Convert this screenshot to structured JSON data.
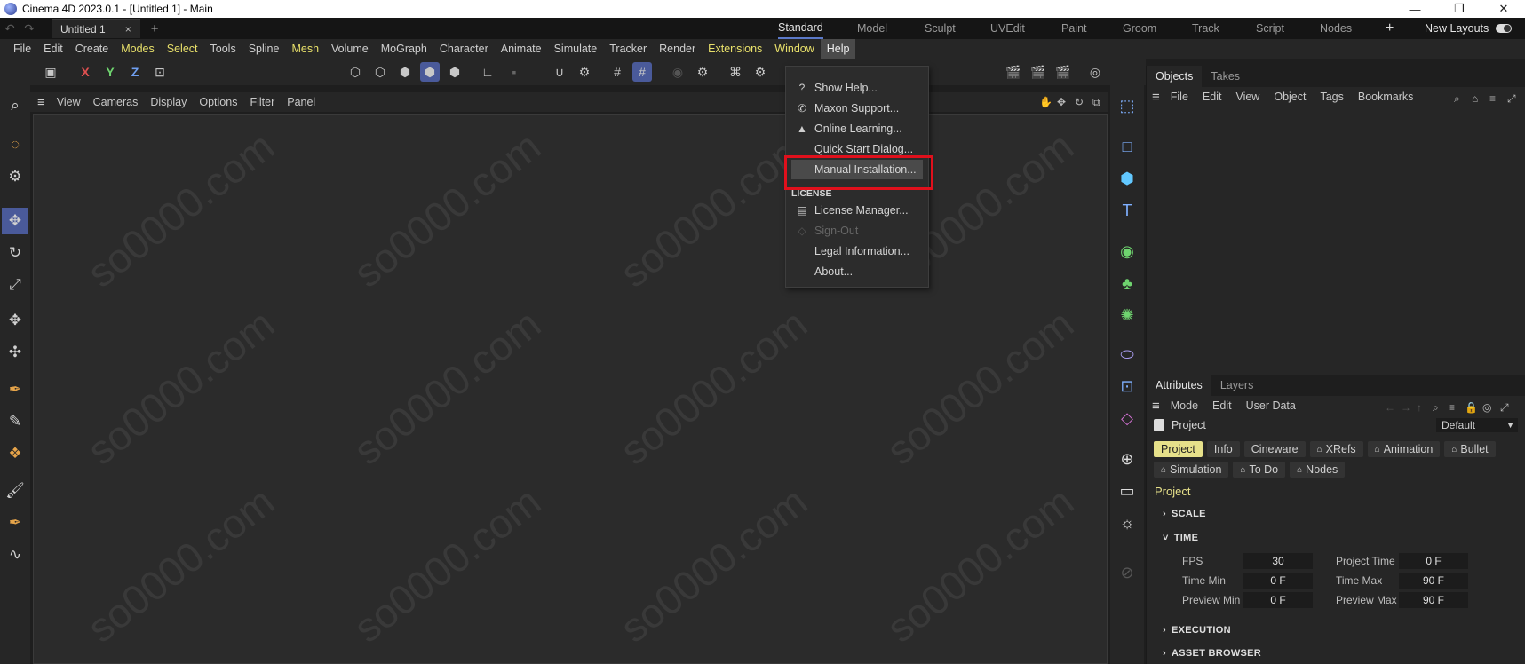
{
  "window": {
    "title": "Cinema 4D 2023.0.1 - [Untitled 1] - Main"
  },
  "doc_tab": {
    "label": "Untitled 1",
    "close": "×",
    "add": "+"
  },
  "layouts": [
    "Standard",
    "Model",
    "Sculpt",
    "UVEdit",
    "Paint",
    "Groom",
    "Track",
    "Script",
    "Nodes"
  ],
  "layouts_add": "+",
  "new_layouts": "New Layouts",
  "menubar": [
    "File",
    "Edit",
    "Create",
    "Modes",
    "Select",
    "Tools",
    "Spline",
    "Mesh",
    "Volume",
    "MoGraph",
    "Character",
    "Animate",
    "Simulate",
    "Tracker",
    "Render",
    "Extensions",
    "Window",
    "Help"
  ],
  "menubar_highlight": [
    "Modes",
    "Select",
    "Mesh",
    "Extensions",
    "Window"
  ],
  "menubar_active": "Help",
  "axes": [
    "X",
    "Y",
    "Z"
  ],
  "viewport_menu": [
    "View",
    "Cameras",
    "Display",
    "Options",
    "Filter",
    "Panel"
  ],
  "help_menu": {
    "items": [
      {
        "label": "Show Help...",
        "icon": "question-icon"
      },
      {
        "label": "Maxon Support...",
        "icon": "phone-icon"
      },
      {
        "label": "Online Learning...",
        "icon": "graduation-cap-icon"
      },
      {
        "label": "Quick Start Dialog...",
        "icon": ""
      },
      {
        "label": "Manual Installation...",
        "icon": ""
      }
    ],
    "license_header": "LICENSE",
    "license_items": [
      {
        "label": "License Manager...",
        "icon": "license-icon",
        "disabled": false
      },
      {
        "label": "Sign-Out",
        "icon": "signout-icon",
        "disabled": true
      },
      {
        "label": "Legal Information...",
        "icon": "",
        "disabled": false
      },
      {
        "label": "About...",
        "icon": "",
        "disabled": false
      }
    ]
  },
  "objects_panel": {
    "tabs": [
      "Objects",
      "Takes"
    ],
    "menu": [
      "File",
      "Edit",
      "View",
      "Object",
      "Tags",
      "Bookmarks"
    ]
  },
  "attributes_panel": {
    "tabs": [
      "Attributes",
      "Layers"
    ],
    "menu": [
      "Mode",
      "Edit",
      "User Data"
    ],
    "object_label": "Project",
    "preset": "Default",
    "chips_row1": [
      "Project",
      "Info",
      "Cineware",
      "XRefs",
      "Animation",
      "Bullet"
    ],
    "chips_row2": [
      "Simulation",
      "To Do",
      "Nodes"
    ],
    "section_title": "Project",
    "sections": {
      "scale": "SCALE",
      "time": "TIME",
      "execution": "EXECUTION",
      "asset_browser": "ASSET BROWSER"
    },
    "fields": {
      "fps_label": "FPS",
      "fps": "30",
      "project_time_label": "Project Time",
      "project_time": "0 F",
      "time_min_label": "Time Min",
      "time_min": "0 F",
      "time_max_label": "Time Max",
      "time_max": "90 F",
      "preview_min_label": "Preview Min",
      "preview_min": "0 F",
      "preview_max_label": "Preview Max",
      "preview_max": "90 F"
    }
  },
  "watermark": "so0000.com",
  "colors": {
    "accent": "#5b79c9",
    "highlight_box": "#e0101c",
    "yellow_menu": "#e8e06a",
    "active_chip": "#e6e08a"
  }
}
